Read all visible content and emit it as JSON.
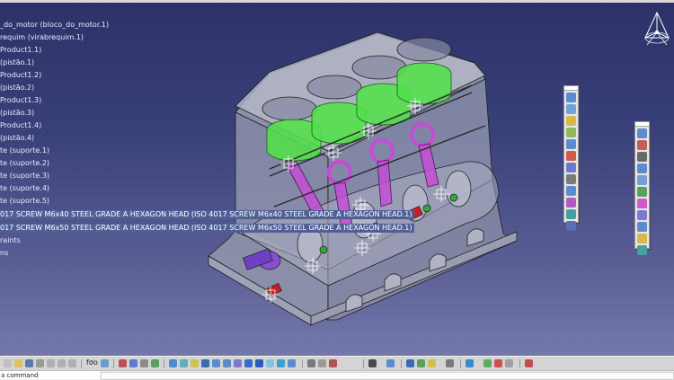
{
  "tree": [
    {
      "label": "_do_motor (bloco_do_motor.1)"
    },
    {
      "label": "requim (virabrequim.1)"
    },
    {
      "label": "Product1.1)"
    },
    {
      "label": "(pistão.1)"
    },
    {
      "label": "Product1.2)"
    },
    {
      "label": "(pistão.2)"
    },
    {
      "label": "Product1.3)"
    },
    {
      "label": "(pistão.3)"
    },
    {
      "label": "Product1.4)"
    },
    {
      "label": "(pistão.4)"
    },
    {
      "label": "te (suporte.1)"
    },
    {
      "label": "te (suporte.2)"
    },
    {
      "label": "te (suporte.3)"
    },
    {
      "label": "te (suporte.4)"
    },
    {
      "label": "te (suporte.5)"
    },
    {
      "label": "017 SCREW M6x40 STEEL GRADE A HEXAGON HEAD (ISO 4017 SCREW M6x40 STEEL GRADE A HEXAGON HEAD.1)"
    },
    {
      "label": "017 SCREW M6x50 STEEL GRADE A HEXAGON HEAD (ISO 4017 SCREW M6x50 STEEL GRADE A HEXAGON HEAD.1)"
    },
    {
      "label": "raints"
    },
    {
      "label": "ns"
    }
  ],
  "bottom_toolbar": {
    "label": "fσo"
  },
  "command": {
    "value": "a command"
  },
  "colors": {
    "background_top": "#2c3168",
    "background_bottom": "#7b7fae",
    "piston": "#52e04a",
    "connecting_rod": "#c84ad8",
    "crank_accent": "#c81f22"
  },
  "icons": {
    "compass": "compass-icon",
    "right_toolbar_1": [
      "assembly-constraint-icon",
      "snap-icon",
      "manipulation-icon",
      "explode-icon",
      "smart-move-icon",
      "clash-icon",
      "section-icon",
      "measure-icon",
      "insert-component-icon",
      "bill-of-material-icon",
      "scene-icon",
      "catalog-icon",
      "replace-icon",
      "reorder-icon"
    ],
    "right_toolbar_2": [
      "fix-icon",
      "coincidence-icon",
      "contact-icon",
      "offset-icon",
      "angle-icon",
      "fix-together-icon",
      "quick-constraint-icon",
      "flexible-icon",
      "change-constraint-icon",
      "reuse-pattern-icon",
      "update-icon"
    ]
  }
}
